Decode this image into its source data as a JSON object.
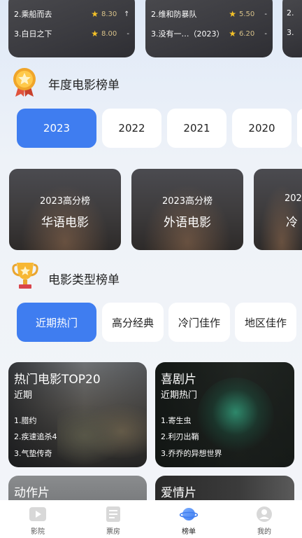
{
  "top_rank_cards": [
    {
      "rows": [
        {
          "title": "2.乘船而去",
          "score": "8.30",
          "trend": "↑"
        },
        {
          "title": "3.白日之下",
          "score": "8.00",
          "trend": "-"
        }
      ]
    },
    {
      "rows": [
        {
          "title": "2.维和防暴队",
          "score": "5.50",
          "trend": "-"
        },
        {
          "title": "3.没有一…（2023）",
          "score": "6.20",
          "trend": "-"
        }
      ]
    },
    {
      "rows": [
        {
          "title": "2.",
          "score": "",
          "trend": ""
        },
        {
          "title": "3.",
          "score": "",
          "trend": ""
        }
      ]
    }
  ],
  "annual": {
    "title": "年度电影榜单",
    "years": [
      "2023",
      "2022",
      "2021",
      "2020"
    ],
    "selected": "2023",
    "banners": [
      {
        "sub": "2023高分榜",
        "main": "华语电影"
      },
      {
        "sub": "2023高分榜",
        "main": "外语电影"
      },
      {
        "sub": "202",
        "main": "冷"
      }
    ]
  },
  "genre": {
    "title": "电影类型榜单",
    "tabs": [
      "近期热门",
      "高分经典",
      "冷门佳作",
      "地区佳作"
    ],
    "selected": "近期热门",
    "cards": [
      {
        "title": "热门电影TOP20",
        "subtitle": "近期",
        "items": [
          "1.腊约",
          "2.疾速追杀4",
          "3.气垫传奇"
        ]
      },
      {
        "title": "喜剧片",
        "subtitle": "近期热门",
        "items": [
          "1.寄生虫",
          "2.利刃出鞘",
          "3.乔乔的异想世界"
        ]
      },
      {
        "title": "动作片",
        "subtitle": "",
        "items": []
      },
      {
        "title": "爱情片",
        "subtitle": "",
        "items": []
      }
    ]
  },
  "nav": {
    "items": [
      {
        "label": "影院",
        "icon": "play-icon"
      },
      {
        "label": "票房",
        "icon": "ticket-icon"
      },
      {
        "label": "榜单",
        "icon": "planet-icon"
      },
      {
        "label": "我的",
        "icon": "user-icon"
      }
    ],
    "active": "榜单"
  },
  "colors": {
    "accent": "#3f7df0",
    "star": "#f5c228"
  }
}
